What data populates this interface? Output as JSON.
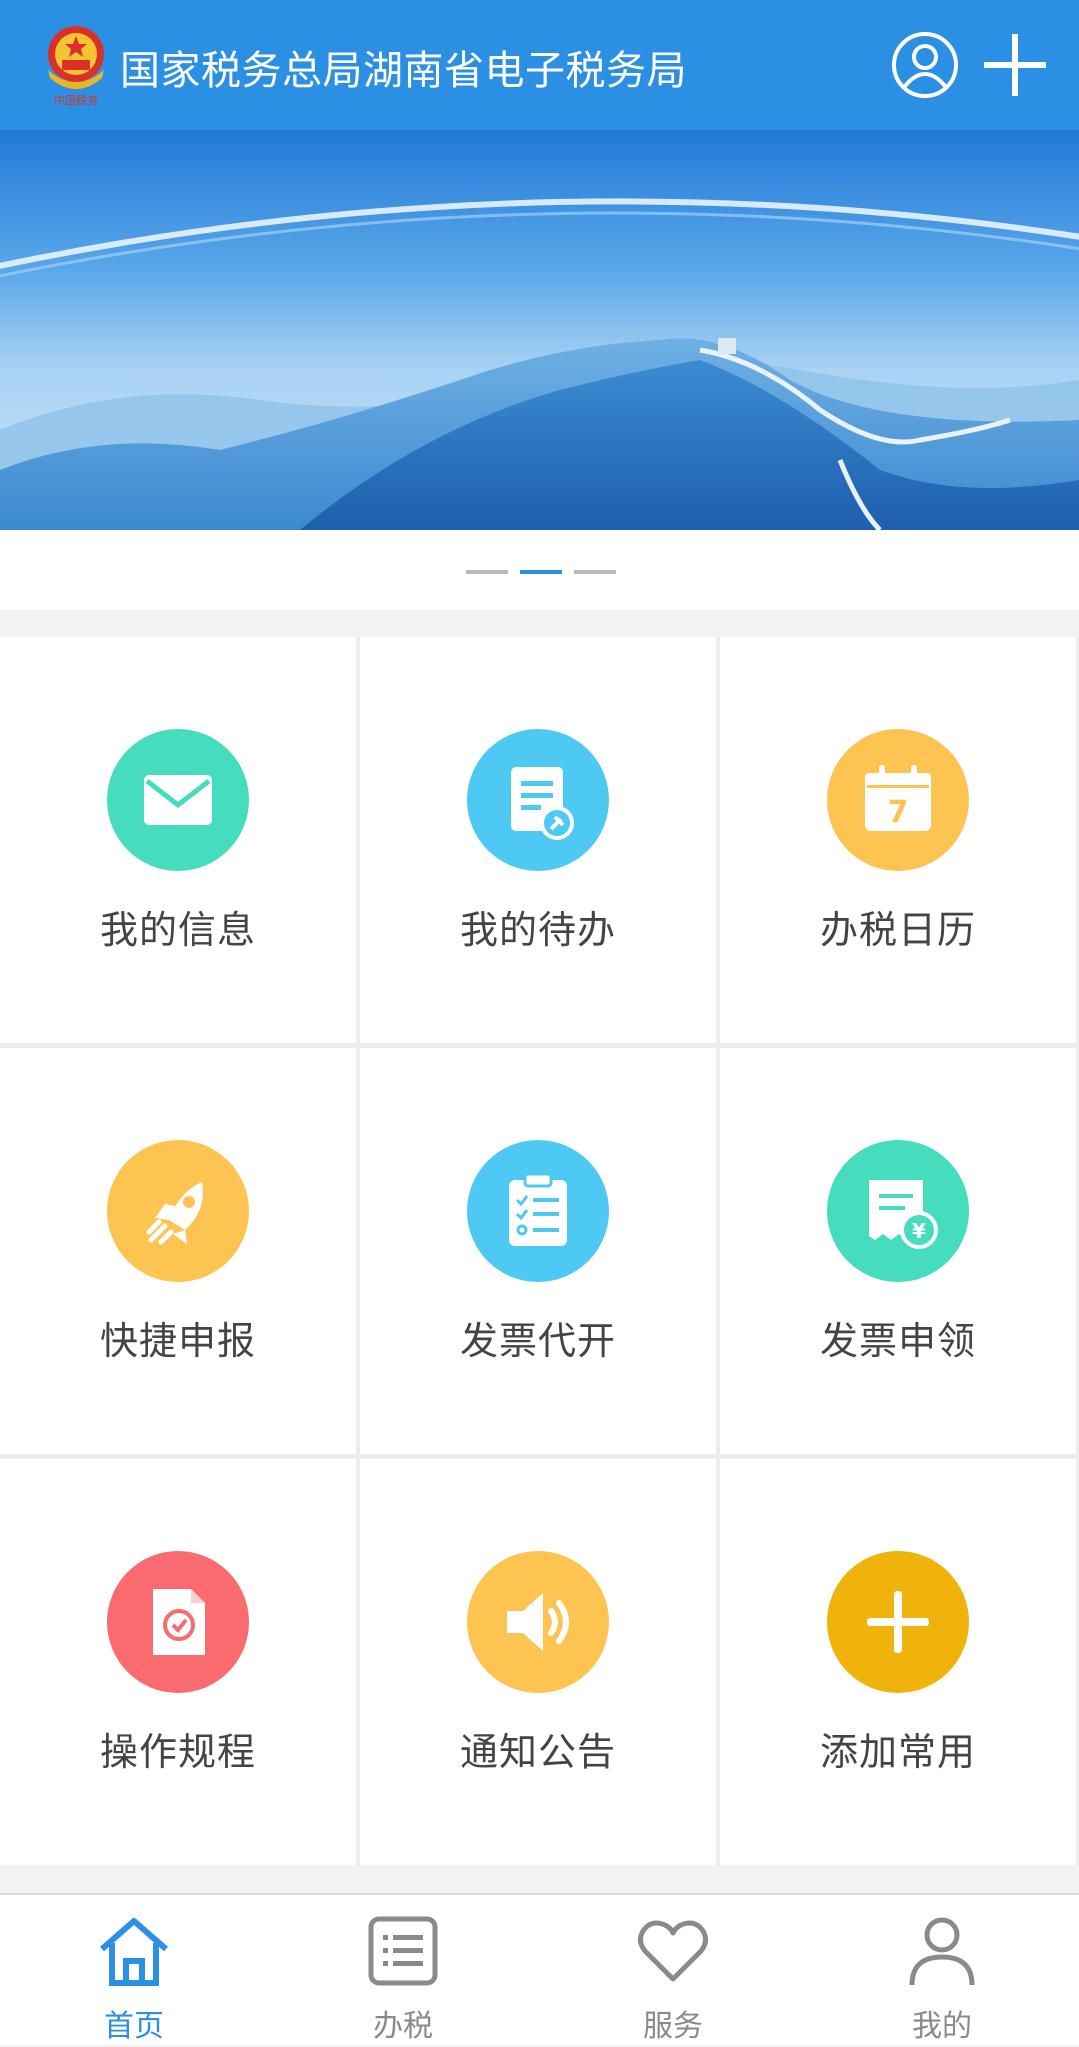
{
  "header": {
    "title": "国家税务总局湖南省电子税务局",
    "logo_text": "中国税务"
  },
  "banner": {
    "slide_count": 3,
    "active_slide": 2
  },
  "menu": [
    {
      "label": "我的信息",
      "icon": "mail-icon",
      "color": "#46dcbe"
    },
    {
      "label": "我的待办",
      "icon": "todo-document-icon",
      "color": "#4dc9f3"
    },
    {
      "label": "办税日历",
      "icon": "calendar-icon",
      "color": "#fec452",
      "calendar_day": "7"
    },
    {
      "label": "快捷申报",
      "icon": "rocket-icon",
      "color": "#fec452"
    },
    {
      "label": "发票代开",
      "icon": "clipboard-checklist-icon",
      "color": "#4dc9f3"
    },
    {
      "label": "发票申领",
      "icon": "invoice-yen-icon",
      "color": "#46dcbe",
      "currency_symbol": "¥"
    },
    {
      "label": "操作规程",
      "icon": "guide-document-icon",
      "color": "#f96b6e"
    },
    {
      "label": "通知公告",
      "icon": "speaker-icon",
      "color": "#fec452"
    },
    {
      "label": "添加常用",
      "icon": "plus-icon",
      "color": "#efb30b"
    }
  ],
  "tabs": [
    {
      "label": "首页",
      "icon": "home-icon",
      "active": true
    },
    {
      "label": "办税",
      "icon": "list-icon",
      "active": false
    },
    {
      "label": "服务",
      "icon": "heart-icon",
      "active": false
    },
    {
      "label": "我的",
      "icon": "person-icon",
      "active": false
    }
  ],
  "colors": {
    "brand_blue": "#2b8fe4",
    "tab_inactive": "#8a8a8a"
  }
}
